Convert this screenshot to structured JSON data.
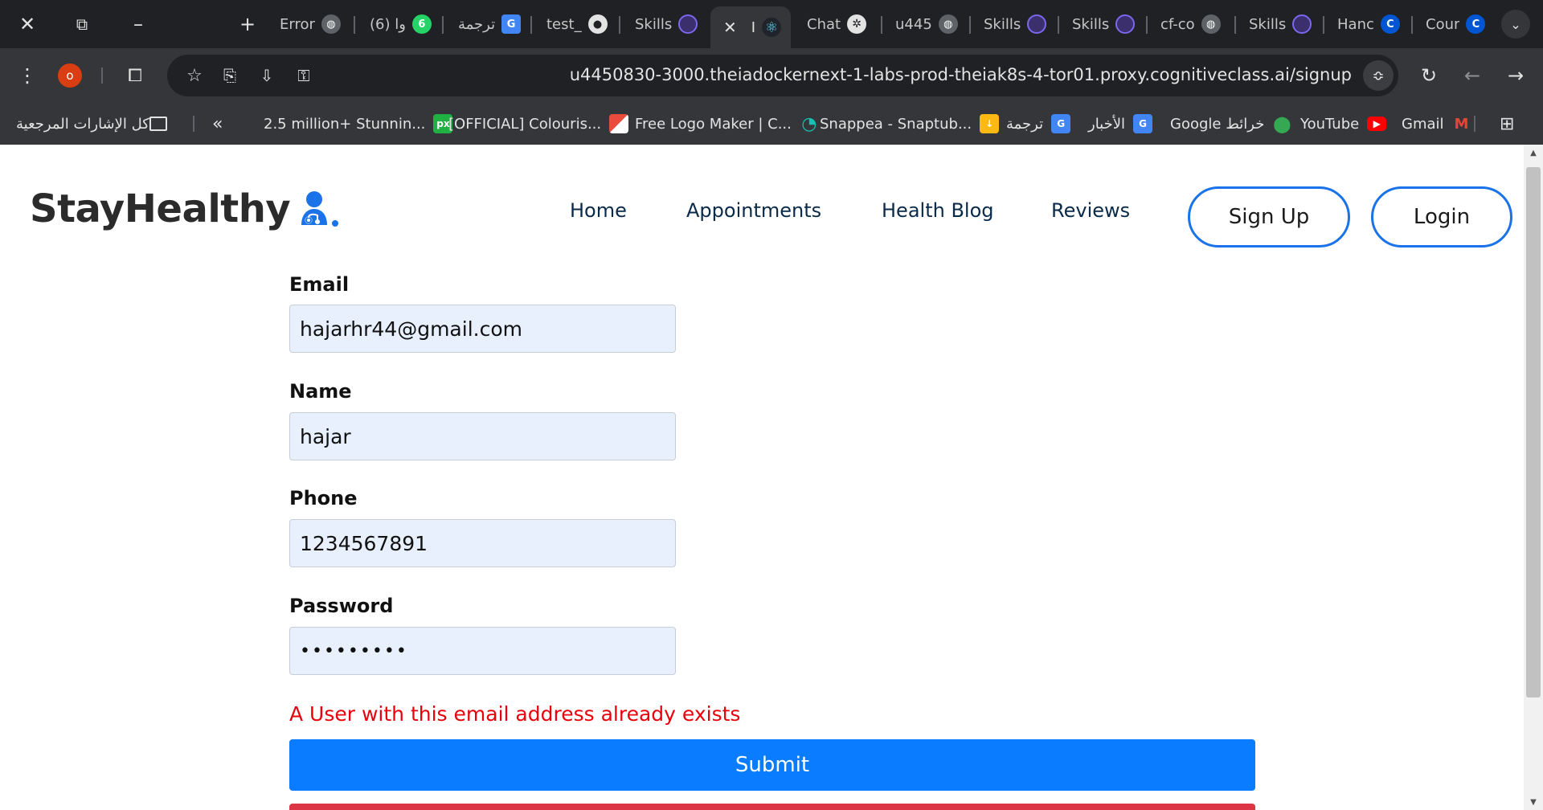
{
  "browser": {
    "tabs": [
      {
        "label": "Error",
        "icon": "globe-icon",
        "color": "#9aa0a6"
      },
      {
        "label": "(6) وا",
        "icon": "whatsapp-icon",
        "color": "#25d366",
        "badge": "6"
      },
      {
        "label": "ترجمة",
        "icon": "translate-icon",
        "color": "#4285f4"
      },
      {
        "label": "test_",
        "icon": "github-icon",
        "color": "#e3e3e3"
      },
      {
        "label": "Skills",
        "icon": "skills-icon",
        "color": "#7b68ee"
      },
      {
        "label": "I",
        "icon": "react-icon",
        "color": "#61dafb",
        "active": true
      },
      {
        "label": "Chat",
        "icon": "openai-icon",
        "color": "#e3e3e3"
      },
      {
        "label": "u445",
        "icon": "globe-icon",
        "color": "#9aa0a6"
      },
      {
        "label": "Skills",
        "icon": "skills-icon",
        "color": "#7b68ee"
      },
      {
        "label": "Skills",
        "icon": "skills-icon",
        "color": "#7b68ee"
      },
      {
        "label": "cf-co",
        "icon": "globe-icon",
        "color": "#9aa0a6"
      },
      {
        "label": "Skills",
        "icon": "skills-icon",
        "color": "#7b68ee"
      },
      {
        "label": "Hanc",
        "icon": "coursera-icon",
        "color": "#0056d2"
      },
      {
        "label": "Cour",
        "icon": "coursera-icon",
        "color": "#0056d2"
      }
    ],
    "url": "u4450830-3000.theiadockernext-1-labs-prod-theiak8s-4-tor01.proxy.cognitiveclass.ai/signup",
    "profile_initial": "o",
    "bookmarks": [
      {
        "label": "كل الإشارات المرجعية",
        "icon": "folder-icon"
      },
      {
        "label": "2.5 million+ Stunnin...",
        "icon": "px-icon",
        "icon_text": "px",
        "color": "#1fb141"
      },
      {
        "label": "[OFFICIAL] Colouris...",
        "icon": "colour-icon",
        "color": "#e94b3c"
      },
      {
        "label": "Free Logo Maker | C...",
        "icon": "logo-maker-icon",
        "color": "#14c1b3"
      },
      {
        "label": "Snappea - Snaptub...",
        "icon": "snappea-icon",
        "color": "#fdb913"
      },
      {
        "label": "ترجمة",
        "icon": "translate-icon",
        "color": "#4285f4"
      },
      {
        "label": "الأخبار",
        "icon": "news-icon",
        "color": "#4285f4"
      },
      {
        "label": "Google خرائط",
        "icon": "maps-icon",
        "color": "#34a853"
      },
      {
        "label": "YouTube",
        "icon": "youtube-icon",
        "color": "#ff0000"
      },
      {
        "label": "Gmail",
        "icon": "gmail-icon",
        "color": "#ea4335"
      }
    ]
  },
  "site": {
    "logo_text": "StayHealthy",
    "accent": "#1a73e8",
    "nav": {
      "home": "Home",
      "appointments": "Appointments",
      "health_blog": "Health Blog",
      "reviews": "Reviews",
      "signup": "Sign Up",
      "login": "Login"
    }
  },
  "form": {
    "email_label": "Email",
    "email_value": "hajarhr44@gmail.com",
    "name_label": "Name",
    "name_value": "hajar",
    "phone_label": "Phone",
    "phone_value": "1234567891",
    "password_label": "Password",
    "password_value": "hajarhr44",
    "error": "A User with this email address already exists",
    "submit_label": "Submit",
    "error_color": "#e8000b",
    "submit_color": "#0a7cff"
  }
}
